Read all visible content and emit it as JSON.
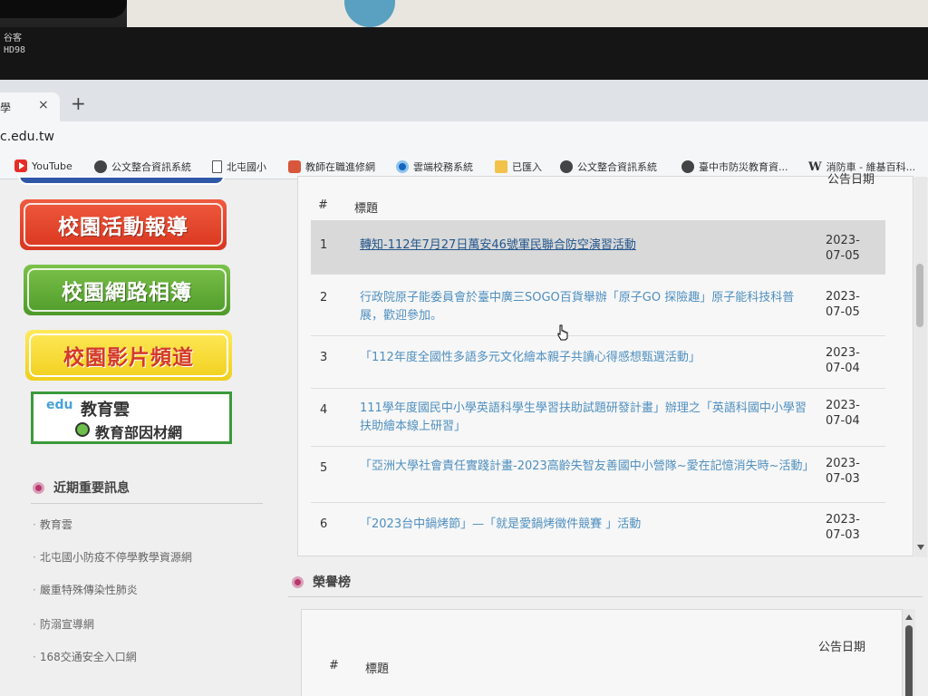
{
  "monitor": {
    "brand": "谷客",
    "model": "HD98"
  },
  "tab": {
    "title": "學",
    "close": "×",
    "new_tab": "+"
  },
  "url": "c.edu.tw",
  "bookmarks": [
    {
      "label": "YouTube",
      "icon": "youtube-icon"
    },
    {
      "label": "公文整合資訊系統",
      "icon": "globe-icon"
    },
    {
      "label": "北屯國小",
      "icon": "document-icon"
    },
    {
      "label": "教師在職進修網",
      "icon": "book-icon"
    },
    {
      "label": "雲端校務系統",
      "icon": "cloud-icon"
    },
    {
      "label": "已匯入",
      "icon": "folder-icon"
    },
    {
      "label": "公文整合資訊系統",
      "icon": "globe-icon"
    },
    {
      "label": "臺中市防災教育資...",
      "icon": "globe-icon"
    },
    {
      "label": "消防車 - 維基百科...",
      "icon": "wikipedia-icon"
    }
  ],
  "sidebar": {
    "banners": [
      {
        "label": "校園活動報導",
        "color": "#e2452b"
      },
      {
        "label": "校園網路相簿",
        "color": "#5fa835"
      },
      {
        "label": "校園影片頻道",
        "color": "#f6de34"
      }
    ],
    "edu_cloud": {
      "logo": "edu",
      "line1": "教育雲",
      "line2": "教育部因材網"
    },
    "recent_heading": "近期重要訊息",
    "links": [
      "教育雲",
      "北屯國小防疫不停學教學資源網",
      "嚴重特殊傳染性肺炎",
      "防溺宣導網",
      "168交通安全入口網"
    ]
  },
  "news": {
    "headers": {
      "num": "#",
      "title": "標題",
      "date": "公告日期"
    },
    "rows": [
      {
        "num": "1",
        "title": "轉知-112年7月27日萬安46號軍民聯合防空演習活動",
        "date": "2023-07-05",
        "active": true
      },
      {
        "num": "2",
        "title": "行政院原子能委員會於臺中廣三SOGO百貨舉辦「原子GO 探險趣」原子能科技科普展，歡迎參加。",
        "date": "2023-07-05",
        "active": false
      },
      {
        "num": "3",
        "title": "「112年度全國性多語多元文化繪本親子共讀心得感想甄選活動」",
        "date": "2023-07-04",
        "active": false
      },
      {
        "num": "4",
        "title": "111學年度國民中小學英語科學生學習扶助試題研發計畫」辦理之「英語科國中小學習扶助繪本線上研習」",
        "date": "2023-07-04",
        "active": false
      },
      {
        "num": "5",
        "title": "「亞洲大學社會責任實踐計畫-2023高齡失智友善國中小營隊~愛在記憶消失時~活動」",
        "date": "2023-07-03",
        "active": false
      },
      {
        "num": "6",
        "title": "「2023台中鍋烤節」—「就是愛鍋烤徵件競賽 」活動",
        "date": "2023-07-03",
        "active": false
      }
    ]
  },
  "honor": {
    "heading": "榮譽榜",
    "headers": {
      "num": "#",
      "title": "標題",
      "date": "公告日期"
    }
  }
}
